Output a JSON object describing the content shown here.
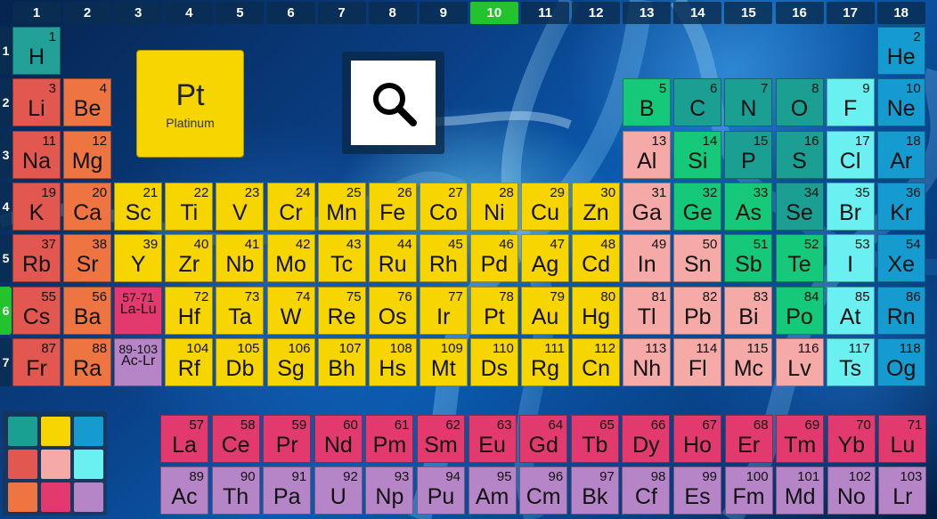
{
  "groups": [
    "1",
    "2",
    "3",
    "4",
    "5",
    "6",
    "7",
    "8",
    "9",
    "10",
    "11",
    "12",
    "13",
    "14",
    "15",
    "16",
    "17",
    "18"
  ],
  "active_group": "10",
  "periods": [
    "1",
    "2",
    "3",
    "4",
    "5",
    "6",
    "7"
  ],
  "active_period": "6",
  "selected": {
    "symbol": "Pt",
    "name": "Platinum"
  },
  "colors": {
    "hydrogen": "#23a199",
    "alkali": "#e2574f",
    "alkaline": "#ee7541",
    "transition": "#f7d500",
    "post_transition": "#f5aaa8",
    "metalloid": "#16c87a",
    "nonmetal": "#1c9f93",
    "halogen": "#6bf0f2",
    "noble": "#169bd0",
    "lanthanide": "#e23a6f",
    "actinide": "#b685c7"
  },
  "elements": [
    {
      "n": "1",
      "s": "H",
      "g": 1,
      "p": 1,
      "t": "hydrogen"
    },
    {
      "n": "2",
      "s": "He",
      "g": 18,
      "p": 1,
      "t": "noble"
    },
    {
      "n": "3",
      "s": "Li",
      "g": 1,
      "p": 2,
      "t": "alkali"
    },
    {
      "n": "4",
      "s": "Be",
      "g": 2,
      "p": 2,
      "t": "alkaline"
    },
    {
      "n": "5",
      "s": "B",
      "g": 13,
      "p": 2,
      "t": "metalloid"
    },
    {
      "n": "6",
      "s": "C",
      "g": 14,
      "p": 2,
      "t": "nonmetal"
    },
    {
      "n": "7",
      "s": "N",
      "g": 15,
      "p": 2,
      "t": "nonmetal"
    },
    {
      "n": "8",
      "s": "O",
      "g": 16,
      "p": 2,
      "t": "nonmetal"
    },
    {
      "n": "9",
      "s": "F",
      "g": 17,
      "p": 2,
      "t": "halogen"
    },
    {
      "n": "10",
      "s": "Ne",
      "g": 18,
      "p": 2,
      "t": "noble"
    },
    {
      "n": "11",
      "s": "Na",
      "g": 1,
      "p": 3,
      "t": "alkali"
    },
    {
      "n": "12",
      "s": "Mg",
      "g": 2,
      "p": 3,
      "t": "alkaline"
    },
    {
      "n": "13",
      "s": "Al",
      "g": 13,
      "p": 3,
      "t": "post_transition"
    },
    {
      "n": "14",
      "s": "Si",
      "g": 14,
      "p": 3,
      "t": "metalloid"
    },
    {
      "n": "15",
      "s": "P",
      "g": 15,
      "p": 3,
      "t": "nonmetal"
    },
    {
      "n": "16",
      "s": "S",
      "g": 16,
      "p": 3,
      "t": "nonmetal"
    },
    {
      "n": "17",
      "s": "Cl",
      "g": 17,
      "p": 3,
      "t": "halogen"
    },
    {
      "n": "18",
      "s": "Ar",
      "g": 18,
      "p": 3,
      "t": "noble"
    },
    {
      "n": "19",
      "s": "K",
      "g": 1,
      "p": 4,
      "t": "alkali"
    },
    {
      "n": "20",
      "s": "Ca",
      "g": 2,
      "p": 4,
      "t": "alkaline"
    },
    {
      "n": "21",
      "s": "Sc",
      "g": 3,
      "p": 4,
      "t": "transition"
    },
    {
      "n": "22",
      "s": "Ti",
      "g": 4,
      "p": 4,
      "t": "transition"
    },
    {
      "n": "23",
      "s": "V",
      "g": 5,
      "p": 4,
      "t": "transition"
    },
    {
      "n": "24",
      "s": "Cr",
      "g": 6,
      "p": 4,
      "t": "transition"
    },
    {
      "n": "25",
      "s": "Mn",
      "g": 7,
      "p": 4,
      "t": "transition"
    },
    {
      "n": "26",
      "s": "Fe",
      "g": 8,
      "p": 4,
      "t": "transition"
    },
    {
      "n": "27",
      "s": "Co",
      "g": 9,
      "p": 4,
      "t": "transition"
    },
    {
      "n": "28",
      "s": "Ni",
      "g": 10,
      "p": 4,
      "t": "transition"
    },
    {
      "n": "29",
      "s": "Cu",
      "g": 11,
      "p": 4,
      "t": "transition"
    },
    {
      "n": "30",
      "s": "Zn",
      "g": 12,
      "p": 4,
      "t": "transition"
    },
    {
      "n": "31",
      "s": "Ga",
      "g": 13,
      "p": 4,
      "t": "post_transition"
    },
    {
      "n": "32",
      "s": "Ge",
      "g": 14,
      "p": 4,
      "t": "metalloid"
    },
    {
      "n": "33",
      "s": "As",
      "g": 15,
      "p": 4,
      "t": "metalloid"
    },
    {
      "n": "34",
      "s": "Se",
      "g": 16,
      "p": 4,
      "t": "nonmetal"
    },
    {
      "n": "35",
      "s": "Br",
      "g": 17,
      "p": 4,
      "t": "halogen"
    },
    {
      "n": "36",
      "s": "Kr",
      "g": 18,
      "p": 4,
      "t": "noble"
    },
    {
      "n": "37",
      "s": "Rb",
      "g": 1,
      "p": 5,
      "t": "alkali"
    },
    {
      "n": "38",
      "s": "Sr",
      "g": 2,
      "p": 5,
      "t": "alkaline"
    },
    {
      "n": "39",
      "s": "Y",
      "g": 3,
      "p": 5,
      "t": "transition"
    },
    {
      "n": "40",
      "s": "Zr",
      "g": 4,
      "p": 5,
      "t": "transition"
    },
    {
      "n": "41",
      "s": "Nb",
      "g": 5,
      "p": 5,
      "t": "transition"
    },
    {
      "n": "42",
      "s": "Mo",
      "g": 6,
      "p": 5,
      "t": "transition"
    },
    {
      "n": "43",
      "s": "Tc",
      "g": 7,
      "p": 5,
      "t": "transition"
    },
    {
      "n": "44",
      "s": "Ru",
      "g": 8,
      "p": 5,
      "t": "transition"
    },
    {
      "n": "45",
      "s": "Rh",
      "g": 9,
      "p": 5,
      "t": "transition"
    },
    {
      "n": "46",
      "s": "Pd",
      "g": 10,
      "p": 5,
      "t": "transition"
    },
    {
      "n": "47",
      "s": "Ag",
      "g": 11,
      "p": 5,
      "t": "transition"
    },
    {
      "n": "48",
      "s": "Cd",
      "g": 12,
      "p": 5,
      "t": "transition"
    },
    {
      "n": "49",
      "s": "In",
      "g": 13,
      "p": 5,
      "t": "post_transition"
    },
    {
      "n": "50",
      "s": "Sn",
      "g": 14,
      "p": 5,
      "t": "post_transition"
    },
    {
      "n": "51",
      "s": "Sb",
      "g": 15,
      "p": 5,
      "t": "metalloid"
    },
    {
      "n": "52",
      "s": "Te",
      "g": 16,
      "p": 5,
      "t": "metalloid"
    },
    {
      "n": "53",
      "s": "I",
      "g": 17,
      "p": 5,
      "t": "halogen"
    },
    {
      "n": "54",
      "s": "Xe",
      "g": 18,
      "p": 5,
      "t": "noble"
    },
    {
      "n": "55",
      "s": "Cs",
      "g": 1,
      "p": 6,
      "t": "alkali"
    },
    {
      "n": "56",
      "s": "Ba",
      "g": 2,
      "p": 6,
      "t": "alkaline"
    },
    {
      "n": "57-71",
      "s": "La-Lu",
      "g": 3,
      "p": 6,
      "t": "lanthanide",
      "range": true
    },
    {
      "n": "72",
      "s": "Hf",
      "g": 4,
      "p": 6,
      "t": "transition"
    },
    {
      "n": "73",
      "s": "Ta",
      "g": 5,
      "p": 6,
      "t": "transition"
    },
    {
      "n": "74",
      "s": "W",
      "g": 6,
      "p": 6,
      "t": "transition"
    },
    {
      "n": "75",
      "s": "Re",
      "g": 7,
      "p": 6,
      "t": "transition"
    },
    {
      "n": "76",
      "s": "Os",
      "g": 8,
      "p": 6,
      "t": "transition"
    },
    {
      "n": "77",
      "s": "Ir",
      "g": 9,
      "p": 6,
      "t": "transition"
    },
    {
      "n": "78",
      "s": "Pt",
      "g": 10,
      "p": 6,
      "t": "transition"
    },
    {
      "n": "79",
      "s": "Au",
      "g": 11,
      "p": 6,
      "t": "transition"
    },
    {
      "n": "80",
      "s": "Hg",
      "g": 12,
      "p": 6,
      "t": "transition"
    },
    {
      "n": "81",
      "s": "Tl",
      "g": 13,
      "p": 6,
      "t": "post_transition"
    },
    {
      "n": "82",
      "s": "Pb",
      "g": 14,
      "p": 6,
      "t": "post_transition"
    },
    {
      "n": "83",
      "s": "Bi",
      "g": 15,
      "p": 6,
      "t": "post_transition"
    },
    {
      "n": "84",
      "s": "Po",
      "g": 16,
      "p": 6,
      "t": "metalloid"
    },
    {
      "n": "85",
      "s": "At",
      "g": 17,
      "p": 6,
      "t": "halogen"
    },
    {
      "n": "86",
      "s": "Rn",
      "g": 18,
      "p": 6,
      "t": "noble"
    },
    {
      "n": "87",
      "s": "Fr",
      "g": 1,
      "p": 7,
      "t": "alkali"
    },
    {
      "n": "88",
      "s": "Ra",
      "g": 2,
      "p": 7,
      "t": "alkaline"
    },
    {
      "n": "89-103",
      "s": "Ac-Lr",
      "g": 3,
      "p": 7,
      "t": "actinide",
      "range": true
    },
    {
      "n": "104",
      "s": "Rf",
      "g": 4,
      "p": 7,
      "t": "transition"
    },
    {
      "n": "105",
      "s": "Db",
      "g": 5,
      "p": 7,
      "t": "transition"
    },
    {
      "n": "106",
      "s": "Sg",
      "g": 6,
      "p": 7,
      "t": "transition"
    },
    {
      "n": "107",
      "s": "Bh",
      "g": 7,
      "p": 7,
      "t": "transition"
    },
    {
      "n": "108",
      "s": "Hs",
      "g": 8,
      "p": 7,
      "t": "transition"
    },
    {
      "n": "109",
      "s": "Mt",
      "g": 9,
      "p": 7,
      "t": "transition"
    },
    {
      "n": "110",
      "s": "Ds",
      "g": 10,
      "p": 7,
      "t": "transition"
    },
    {
      "n": "111",
      "s": "Rg",
      "g": 11,
      "p": 7,
      "t": "transition"
    },
    {
      "n": "112",
      "s": "Cn",
      "g": 12,
      "p": 7,
      "t": "transition"
    },
    {
      "n": "113",
      "s": "Nh",
      "g": 13,
      "p": 7,
      "t": "post_transition"
    },
    {
      "n": "114",
      "s": "Fl",
      "g": 14,
      "p": 7,
      "t": "post_transition"
    },
    {
      "n": "115",
      "s": "Mc",
      "g": 15,
      "p": 7,
      "t": "post_transition"
    },
    {
      "n": "116",
      "s": "Lv",
      "g": 16,
      "p": 7,
      "t": "post_transition"
    },
    {
      "n": "117",
      "s": "Ts",
      "g": 17,
      "p": 7,
      "t": "halogen"
    },
    {
      "n": "118",
      "s": "Og",
      "g": 18,
      "p": 7,
      "t": "noble"
    }
  ],
  "lanthanides": [
    {
      "n": "57",
      "s": "La"
    },
    {
      "n": "58",
      "s": "Ce"
    },
    {
      "n": "59",
      "s": "Pr"
    },
    {
      "n": "60",
      "s": "Nd"
    },
    {
      "n": "61",
      "s": "Pm"
    },
    {
      "n": "62",
      "s": "Sm"
    },
    {
      "n": "63",
      "s": "Eu"
    },
    {
      "n": "64",
      "s": "Gd"
    },
    {
      "n": "65",
      "s": "Tb"
    },
    {
      "n": "66",
      "s": "Dy"
    },
    {
      "n": "67",
      "s": "Ho"
    },
    {
      "n": "68",
      "s": "Er"
    },
    {
      "n": "69",
      "s": "Tm"
    },
    {
      "n": "70",
      "s": "Yb"
    },
    {
      "n": "71",
      "s": "Lu"
    }
  ],
  "actinides": [
    {
      "n": "89",
      "s": "Ac"
    },
    {
      "n": "90",
      "s": "Th"
    },
    {
      "n": "91",
      "s": "Pa"
    },
    {
      "n": "92",
      "s": "U"
    },
    {
      "n": "93",
      "s": "Np"
    },
    {
      "n": "94",
      "s": "Pu"
    },
    {
      "n": "95",
      "s": "Am"
    },
    {
      "n": "96",
      "s": "Cm"
    },
    {
      "n": "97",
      "s": "Bk"
    },
    {
      "n": "98",
      "s": "Cf"
    },
    {
      "n": "99",
      "s": "Es"
    },
    {
      "n": "100",
      "s": "Fm"
    },
    {
      "n": "101",
      "s": "Md"
    },
    {
      "n": "102",
      "s": "No"
    },
    {
      "n": "103",
      "s": "Lr"
    }
  ],
  "legend_swatches": [
    "nonmetal",
    "transition",
    "noble",
    "alkali",
    "post_transition",
    "halogen",
    "alkaline",
    "lanthanide",
    "actinide"
  ],
  "icons": {
    "search": "magnifier-icon"
  }
}
